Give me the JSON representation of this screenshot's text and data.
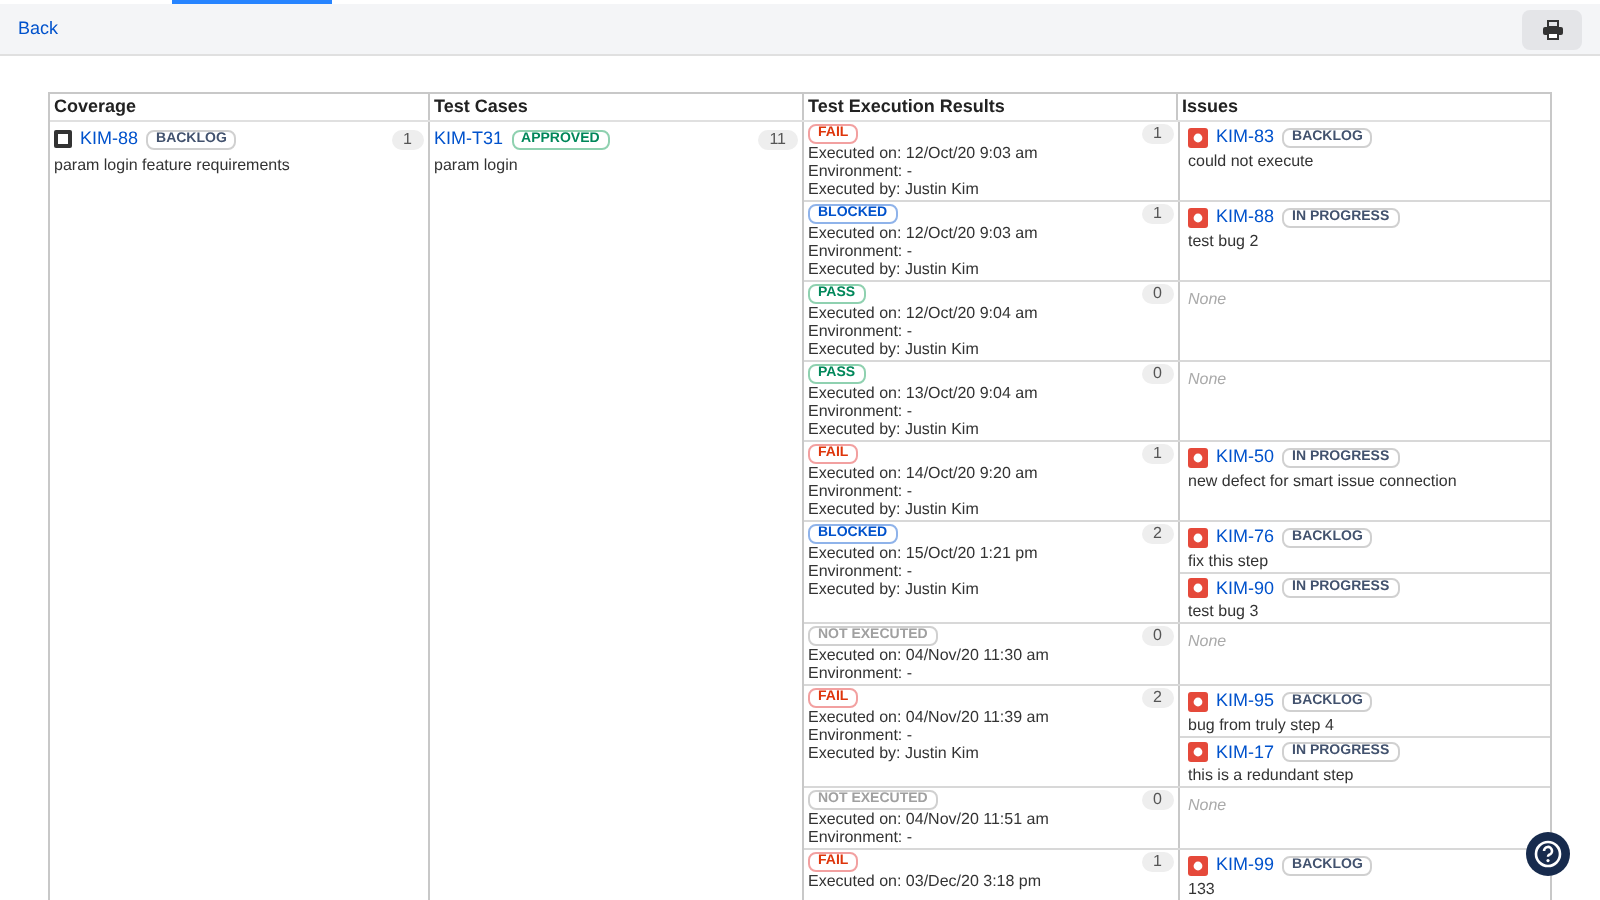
{
  "toolbar": {
    "back_link": "Back"
  },
  "table": {
    "columns": [
      "Coverage",
      "Test Cases",
      "Test Execution Results",
      "Issues"
    ],
    "coverage": {
      "key": "KIM-88",
      "status": "BACKLOG",
      "summary": "param login feature requirements",
      "count": "1"
    },
    "test_case": {
      "key": "KIM-T31",
      "status": "APPROVED",
      "summary": "param login",
      "count": "11"
    },
    "executions": [
      {
        "status": "FAIL",
        "kind": "fail",
        "lines": [
          "Executed on: 12/Oct/20 9:03 am",
          "Environment: -",
          "Executed by: Justin Kim"
        ],
        "count": "1",
        "issues": [
          {
            "key": "KIM-83",
            "status": "BACKLOG",
            "summary": "could not execute"
          }
        ]
      },
      {
        "status": "BLOCKED",
        "kind": "blocked",
        "lines": [
          "Executed on: 12/Oct/20 9:03 am",
          "Environment: -",
          "Executed by: Justin Kim"
        ],
        "count": "1",
        "issues": [
          {
            "key": "KIM-88",
            "status": "IN PROGRESS",
            "summary": "test bug 2"
          }
        ]
      },
      {
        "status": "PASS",
        "kind": "pass",
        "lines": [
          "Executed on: 12/Oct/20 9:04 am",
          "Environment: -",
          "Executed by: Justin Kim"
        ],
        "count": "0",
        "none": "None"
      },
      {
        "status": "PASS",
        "kind": "pass",
        "lines": [
          "Executed on: 13/Oct/20 9:04 am",
          "Environment: -",
          "Executed by: Justin Kim"
        ],
        "count": "0",
        "none": "None"
      },
      {
        "status": "FAIL",
        "kind": "fail",
        "lines": [
          "Executed on: 14/Oct/20 9:20 am",
          "Environment: -",
          "Executed by: Justin Kim"
        ],
        "count": "1",
        "issues": [
          {
            "key": "KIM-50",
            "status": "IN PROGRESS",
            "summary": "new defect for smart issue connection"
          }
        ]
      },
      {
        "status": "BLOCKED",
        "kind": "blocked",
        "lines": [
          "Executed on: 15/Oct/20 1:21 pm",
          "Environment: -",
          "Executed by: Justin Kim"
        ],
        "count": "2",
        "issues": [
          {
            "key": "KIM-76",
            "status": "BACKLOG",
            "summary": "fix this step"
          },
          {
            "key": "KIM-90",
            "status": "IN PROGRESS",
            "summary": "test bug 3"
          }
        ]
      },
      {
        "status": "NOT EXECUTED",
        "kind": "not_executed",
        "lines": [
          "Executed on: 04/Nov/20 11:30 am",
          "Environment: -"
        ],
        "count": "0",
        "none": "None"
      },
      {
        "status": "FAIL",
        "kind": "fail",
        "lines": [
          "Executed on: 04/Nov/20 11:39 am",
          "Environment: -",
          "Executed by: Justin Kim"
        ],
        "count": "2",
        "issues": [
          {
            "key": "KIM-95",
            "status": "BACKLOG",
            "summary": "bug from truly step 4"
          },
          {
            "key": "KIM-17",
            "status": "IN PROGRESS",
            "summary": "this is a redundant step"
          }
        ]
      },
      {
        "status": "NOT EXECUTED",
        "kind": "not_executed",
        "lines": [
          "Executed on: 04/Nov/20 11:51 am",
          "Environment: -"
        ],
        "count": "0",
        "none": "None"
      },
      {
        "status": "FAIL",
        "kind": "fail",
        "lines": [
          "Executed on: 03/Dec/20 3:18 pm"
        ],
        "count": "1",
        "issues": [
          {
            "key": "KIM-99",
            "status": "BACKLOG",
            "summary": "133"
          }
        ]
      }
    ]
  }
}
